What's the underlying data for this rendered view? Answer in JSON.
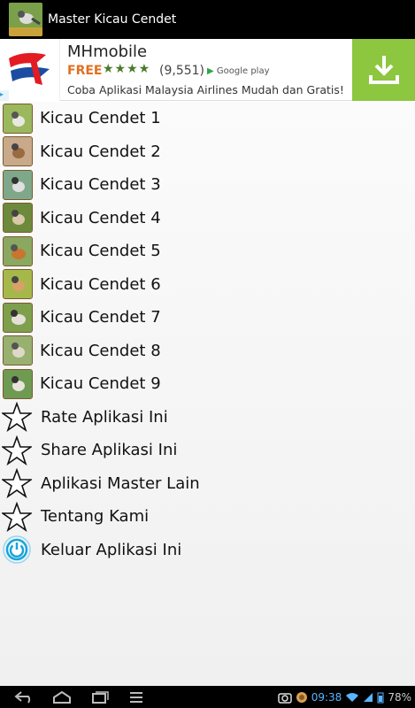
{
  "titlebar": {
    "title": "Master Kicau Cendet",
    "icon": "bird-app-icon"
  },
  "ad": {
    "title": "MHmobile",
    "free": "FREE",
    "stars": "★★★★",
    "rating_count": "(9,551)",
    "store": "Google play",
    "description": "Coba Aplikasi Malaysia Airlines Mudah dan Gratis!",
    "download_color": "#8dc63f"
  },
  "menu": {
    "birds": [
      {
        "label": "Kicau Cendet 1"
      },
      {
        "label": "Kicau Cendet 2"
      },
      {
        "label": "Kicau Cendet 3"
      },
      {
        "label": "Kicau Cendet 4"
      },
      {
        "label": "Kicau Cendet 5"
      },
      {
        "label": "Kicau Cendet 6"
      },
      {
        "label": "Kicau Cendet 7"
      },
      {
        "label": "Kicau Cendet 8"
      },
      {
        "label": "Kicau Cendet 9"
      }
    ],
    "actions": [
      {
        "label": "Rate Aplikasi Ini",
        "icon": "star-icon"
      },
      {
        "label": "Share Aplikasi Ini",
        "icon": "star-icon"
      },
      {
        "label": "Aplikasi Master Lain",
        "icon": "star-icon"
      },
      {
        "label": "Tentang Kami",
        "icon": "star-icon"
      },
      {
        "label": "Keluar Aplikasi Ini",
        "icon": "power-icon"
      }
    ]
  },
  "status": {
    "time": "09:38",
    "battery": "78%"
  }
}
